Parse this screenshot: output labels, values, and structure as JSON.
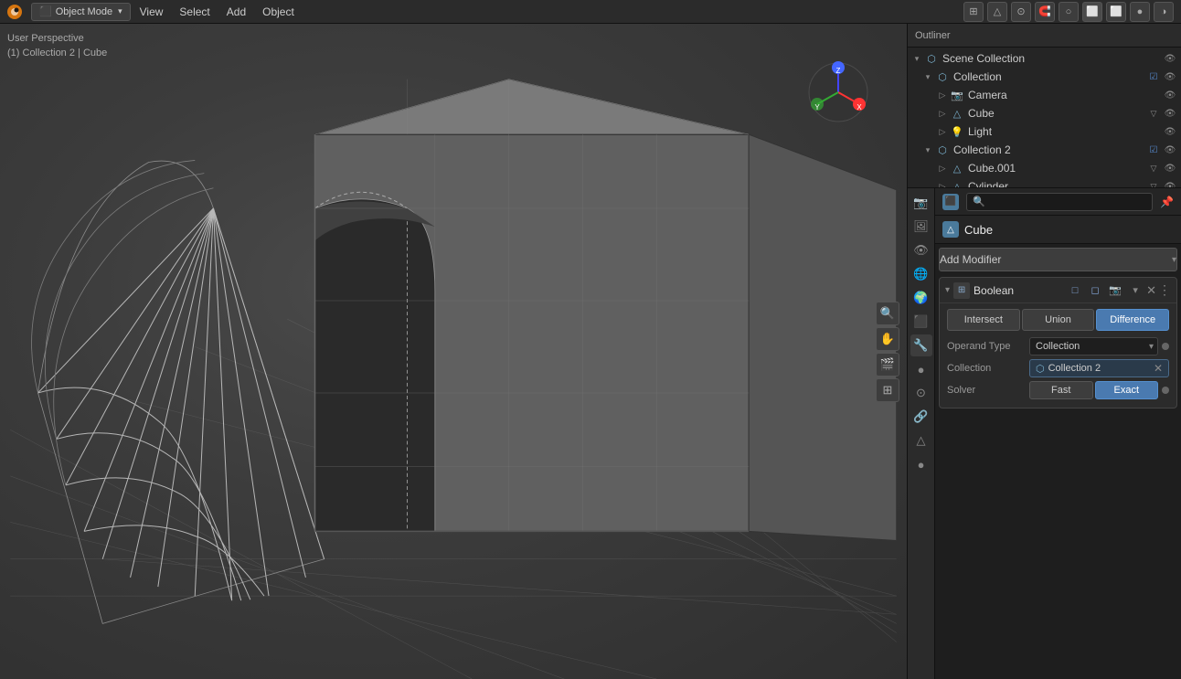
{
  "topbar": {
    "mode": "Object Mode",
    "menu_items": [
      "View",
      "Select",
      "Add",
      "Object"
    ],
    "mode_icon": "⬛"
  },
  "viewport": {
    "info_line1": "User Perspective",
    "info_line2": "(1) Collection 2 | Cube",
    "tools": [
      "🔍",
      "✋",
      "🎬",
      "⊞"
    ],
    "gizmo": {
      "x_label": "X",
      "y_label": "Y",
      "z_label": "Z"
    }
  },
  "outliner": {
    "title": "Scene Collection",
    "items": [
      {
        "id": "scene-collection",
        "label": "Scene Collection",
        "indent": 0,
        "expanded": true,
        "icon": "scene",
        "has_check": false,
        "visible": true
      },
      {
        "id": "collection",
        "label": "Collection",
        "indent": 1,
        "expanded": true,
        "icon": "collection",
        "has_check": true,
        "visible": true
      },
      {
        "id": "camera",
        "label": "Camera",
        "indent": 2,
        "expanded": false,
        "icon": "camera",
        "has_check": false,
        "visible": true
      },
      {
        "id": "cube",
        "label": "Cube",
        "indent": 2,
        "expanded": false,
        "icon": "cube",
        "has_check": false,
        "visible": true
      },
      {
        "id": "light",
        "label": "Light",
        "indent": 2,
        "expanded": false,
        "icon": "light",
        "has_check": false,
        "visible": true
      },
      {
        "id": "collection2",
        "label": "Collection 2",
        "indent": 1,
        "expanded": true,
        "icon": "collection",
        "has_check": true,
        "visible": true
      },
      {
        "id": "cube001",
        "label": "Cube.001",
        "indent": 2,
        "expanded": false,
        "icon": "cube",
        "has_check": false,
        "visible": true
      },
      {
        "id": "cylinder",
        "label": "Cylinder",
        "indent": 2,
        "expanded": false,
        "icon": "cube",
        "has_check": false,
        "visible": true
      }
    ]
  },
  "properties": {
    "search_placeholder": "🔍",
    "object_name": "Cube",
    "object_icon": "⬛",
    "add_modifier_label": "Add Modifier",
    "modifier": {
      "name": "Boolean",
      "icon": "B",
      "operations": [
        {
          "id": "intersect",
          "label": "Intersect",
          "active": false
        },
        {
          "id": "union",
          "label": "Union",
          "active": false
        },
        {
          "id": "difference",
          "label": "Difference",
          "active": true
        }
      ],
      "operand_type_label": "Operand Type",
      "operand_type_value": "Collection",
      "collection_label": "Collection",
      "collection_value": "Collection 2",
      "solver_label": "Solver",
      "solver_options": [
        {
          "id": "fast",
          "label": "Fast",
          "active": false
        },
        {
          "id": "exact",
          "label": "Exact",
          "active": true
        }
      ]
    }
  },
  "prop_sidebar_icons": [
    "🔧",
    "🔵",
    "📷",
    "🖼",
    "🔩",
    "🎯",
    "🌊",
    "🔗",
    "🎨",
    "🌐"
  ],
  "colors": {
    "active_btn": "#4a7ab0",
    "collection_bg": "#2a3a4a",
    "accent": "#5590d0"
  }
}
